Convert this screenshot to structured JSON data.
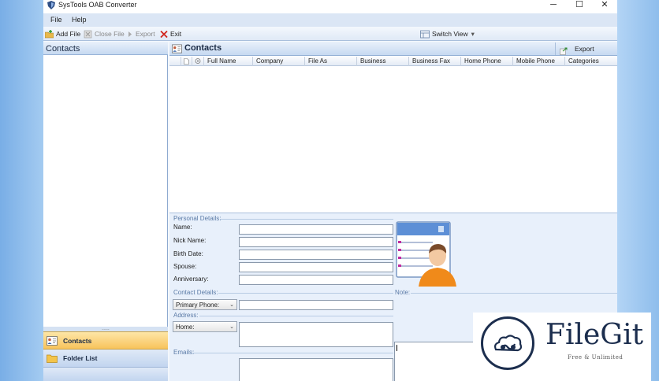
{
  "window": {
    "title": "SysTools OAB Converter",
    "controls": {
      "minimize": "─",
      "maximize": "☐",
      "close": "✕"
    }
  },
  "menu": {
    "file": "File",
    "help": "Help"
  },
  "toolbar": {
    "add_file": "Add File",
    "close_file": "Close File",
    "export": "Export",
    "exit": "Exit",
    "switch_view": "Switch View",
    "switch_view_arrow": "▾"
  },
  "left_panel": {
    "title": "Contacts",
    "splitter_grip": ".....",
    "nav": {
      "contacts": "Contacts",
      "folder_list": "Folder List"
    }
  },
  "right_panel": {
    "title": "Contacts",
    "export_button": "Export",
    "columns": [
      "Full Name",
      "Company",
      "File As",
      "Business",
      "Business Fax",
      "Home Phone",
      "Mobile Phone",
      "Categories"
    ]
  },
  "details": {
    "personal_section": "Personal Details:",
    "fields": {
      "name": "Name:",
      "nick_name": "Nick Name:",
      "birth_date": "Birth Date:",
      "spouse": "Spouse:",
      "anniversary": "Anniversary:"
    },
    "contact_section": "Contact Details:",
    "phone_select": "Primary Phone:",
    "note_label": "Note:",
    "address_label": "Address:",
    "address_select": "Home:",
    "emails_label": "Emails:",
    "dropdown_arrow": "⌄"
  },
  "watermark": {
    "brand": "FileGit",
    "tagline": "Free & Unlimited"
  },
  "colors": {
    "accent": "#f8c35b",
    "panel_header": "#c6d9f1",
    "brand": "#1c2e4e"
  }
}
